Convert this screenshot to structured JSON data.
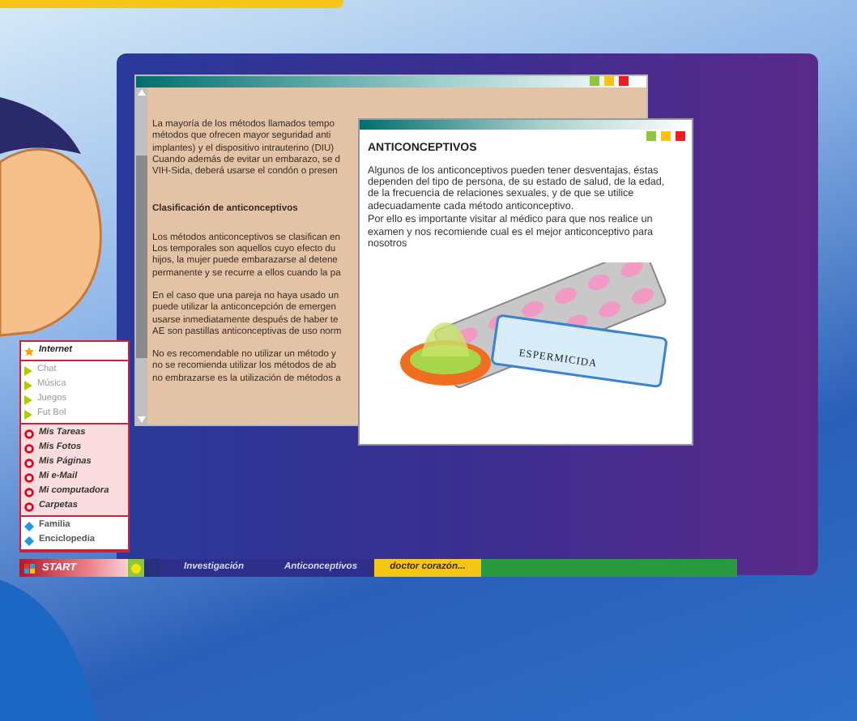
{
  "back_window": {
    "paragraphs": [
      {
        "kind": "text",
        "lines": [
          "La mayoría de los métodos llamados tempo",
          "métodos que ofrecen mayor seguridad anti",
          "implantes) y el dispositivo intrauterino (DIU)",
          "Cuando además de evitar un embarazo, se d",
          "VIH-Sida, deberá usarse el condón  o presen"
        ]
      },
      {
        "kind": "heading",
        "lines": [
          "Clasificación de anticonceptivos"
        ]
      },
      {
        "kind": "text",
        "lines": [
          "Los métodos anticonceptivos se clasifican en",
          "Los temporales son aquellos cuyo efecto du",
          "hijos, la mujer puede embarazarse al detene",
          "permanente y se recurre a ellos cuando la pa"
        ]
      },
      {
        "kind": "text",
        "lines": [
          "En el caso que una pareja no haya usado un",
          "puede utilizar la anticoncepción de emergen",
          "usarse inmediatamente después de haber te",
          "AE son pastillas anticonceptivas de uso norm"
        ]
      },
      {
        "kind": "text",
        "lines": [
          "No es recomendable no utilizar un método y",
          "no se recomienda utilizar los métodos de ab",
          "no embrazarse es la utilización de métodos a"
        ]
      }
    ]
  },
  "front_window": {
    "title": "ANTICONCEPTIVOS",
    "paragraphs": [
      "Algunos de los anticonceptivos pueden tener desventajas, éstas dependen del tipo de persona, de su estado de salud,  de la edad, de la frecuencia de relaciones sexuales, y de que se utilice adecuadamente cada método anticonceptivo.",
      "Por ello es importante visitar al médico para que nos realice un examen y nos recomiende cual es el mejor anticonceptivo para nosotros"
    ],
    "illustration_label": "ESPERMICIDA"
  },
  "start_menu": {
    "groups": [
      {
        "kind": "star",
        "items": [
          "Internet"
        ]
      },
      {
        "kind": "triangle",
        "items": [
          "Chat",
          "Música",
          "Juegos",
          "Fut Bol"
        ]
      },
      {
        "kind": "ring",
        "items": [
          "Mis Tareas",
          "Mis Fotos",
          "Mis Páginas",
          "Mi e-Mail",
          "Mi computadora",
          "Carpetas"
        ]
      },
      {
        "kind": "diamond",
        "items": [
          "Familia",
          "Enciclopedia"
        ]
      }
    ]
  },
  "start_button": "START",
  "taskbar": {
    "tabs": [
      {
        "label": "Investigación",
        "selected": false
      },
      {
        "label": "Anticonceptivos",
        "selected": false
      },
      {
        "label": "doctor corazón...",
        "selected": true
      }
    ]
  }
}
